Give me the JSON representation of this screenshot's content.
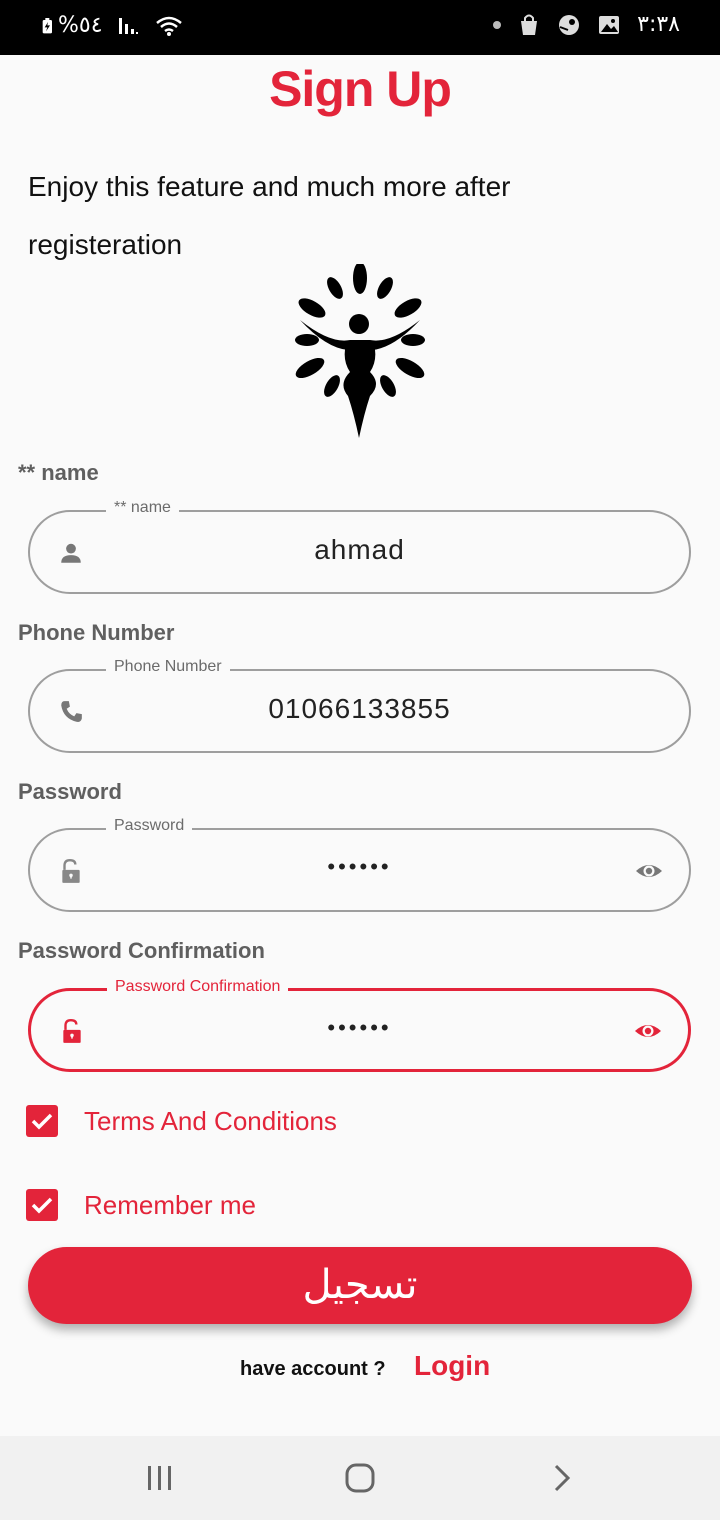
{
  "status_bar": {
    "battery": "%٥٤",
    "time": "٣:٣٨"
  },
  "page": {
    "title": "Sign Up",
    "intro": "Enjoy this feature and much more after registeration"
  },
  "form": {
    "name": {
      "label": "** name",
      "legend": "** name",
      "value": "ahmad",
      "icon": "person-icon"
    },
    "phone": {
      "label": "Phone Number",
      "legend": "Phone Number",
      "value": "01066133855",
      "icon": "phone-icon"
    },
    "password": {
      "label": "Password",
      "legend": "Password",
      "value": "••••••",
      "icon": "lock-open-icon"
    },
    "password_confirmation": {
      "label": "Password Confirmation",
      "legend": "Password Confirmation",
      "value": "••••••",
      "icon": "lock-open-icon"
    }
  },
  "checkboxes": {
    "terms": {
      "label": "Terms And Conditions",
      "checked": true
    },
    "remember": {
      "label": "Remember me",
      "checked": true
    }
  },
  "actions": {
    "register_label": "تسجيل",
    "have_account": "have account ?",
    "login_label": "Login"
  },
  "colors": {
    "accent": "#e3243a",
    "label_grey": "#5f5f5f",
    "border_grey": "#9e9e9e"
  }
}
